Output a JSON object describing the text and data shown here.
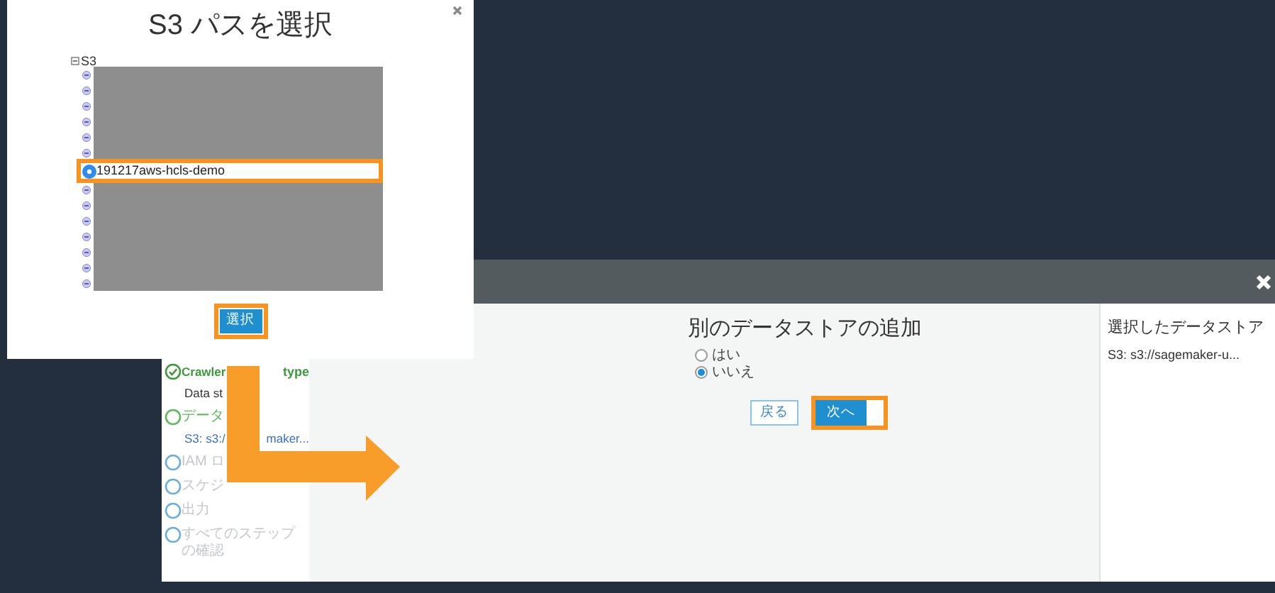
{
  "modal": {
    "title": "S3 パスを選択",
    "tree": {
      "label": "S3",
      "expanded": true,
      "children": [
        {
          "selected": false
        },
        {
          "selected": false
        },
        {
          "selected": false
        },
        {
          "selected": false
        },
        {
          "selected": false
        },
        {
          "selected": false
        },
        {
          "selected": true,
          "label": "191217aws-hcls-demo"
        },
        {
          "selected": false
        },
        {
          "selected": false
        },
        {
          "selected": false
        },
        {
          "selected": false
        },
        {
          "selected": false
        },
        {
          "selected": false
        },
        {
          "selected": false
        }
      ]
    },
    "button": "選択"
  },
  "wizard": {
    "steps": [
      {
        "kind": "done",
        "label": "Crawler",
        "label_tail": "type",
        "detail": "Data st"
      },
      {
        "kind": "current",
        "label": "データ",
        "detail": "S3: s3:/",
        "detail_tail": "maker..."
      },
      {
        "kind": "pending",
        "label": "IAM ロ"
      },
      {
        "kind": "pending",
        "label": "スケジ"
      },
      {
        "kind": "pending",
        "label": "出力"
      },
      {
        "kind": "pending",
        "label": "すべてのステップの確認"
      }
    ],
    "heading": "別のデータストアの追加",
    "options": [
      {
        "label": "はい",
        "selected": false
      },
      {
        "label": "いいえ",
        "selected": true
      }
    ],
    "buttons": [
      {
        "label": "戻る",
        "kind": "secondary"
      },
      {
        "label": "次へ",
        "kind": "primary"
      }
    ],
    "side_panel": {
      "title": "選択したデータストア",
      "items": [
        "S3: s3://sagemaker-u..."
      ]
    }
  }
}
